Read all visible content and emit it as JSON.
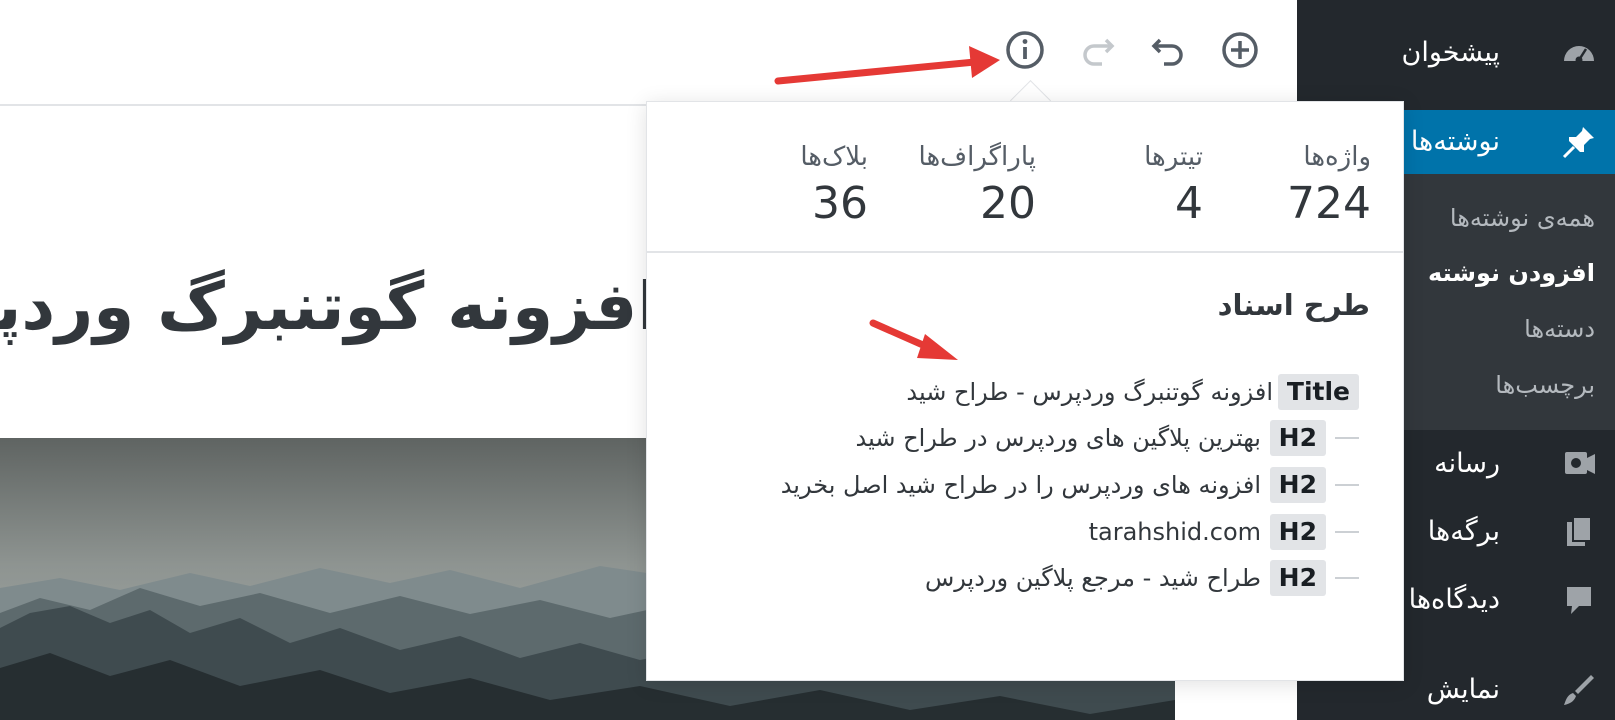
{
  "sidebar": {
    "items": [
      {
        "label": "پیشخوان",
        "icon": "dashboard-icon"
      },
      {
        "label": "نوشته‌ها",
        "icon": "pin-icon"
      },
      {
        "label": "رسانه",
        "icon": "media-icon"
      },
      {
        "label": "برگه‌ها",
        "icon": "pages-icon"
      },
      {
        "label": "دیدگاه‌ها",
        "icon": "comment-icon"
      },
      {
        "label": "نمایش",
        "icon": "appearance-icon"
      }
    ],
    "submenu": [
      "همه‌ی نوشته‌ها",
      "افزودن نوشته",
      "دسته‌ها",
      "برچسب‌ها"
    ],
    "active_item": "نوشته‌ها",
    "active_submenu": "افزودن نوشته",
    "colors": {
      "background": "#23282d",
      "active": "#0073aa",
      "submenu_bg": "#32373c"
    }
  },
  "toolbar": {
    "icons": [
      "add-block-icon",
      "undo-icon",
      "redo-icon",
      "info-icon"
    ]
  },
  "editor": {
    "title": "افزونه گوتنبرگ وردپرس - طراح شید"
  },
  "info_panel": {
    "stats": [
      {
        "label": "واژه‌ها",
        "value": "724"
      },
      {
        "label": "تیترها",
        "value": "4"
      },
      {
        "label": "پاراگراف‌ها",
        "value": "20"
      },
      {
        "label": "بلاک‌ها",
        "value": "36"
      }
    ],
    "outline_title": "طرح اسناد",
    "outline": [
      {
        "tag": "Title",
        "text": "افزونه گوتنبرگ وردپرس - طراح شید"
      },
      {
        "tag": "H2",
        "text": "بهترین پلاگین های وردپرس در طراح شید"
      },
      {
        "tag": "H2",
        "text": "افزونه های وردپرس را در طراح شید اصل بخرید"
      },
      {
        "tag": "H2",
        "text": "tarahshid.com"
      },
      {
        "tag": "H2",
        "text": "طراح شید - مرجع پلاگین وردپرس"
      }
    ]
  },
  "annotation_color": "#e53935"
}
